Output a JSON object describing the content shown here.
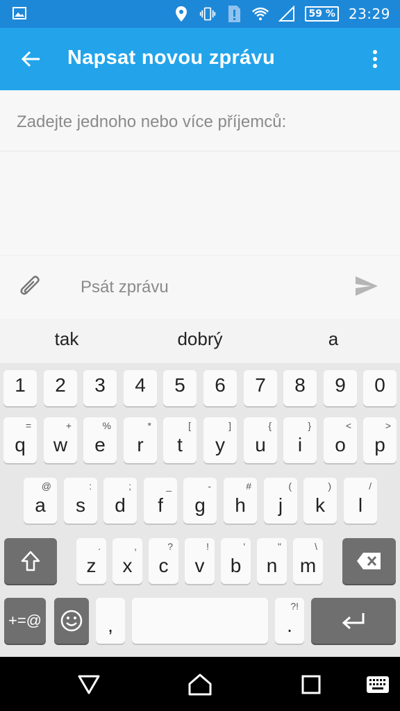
{
  "status_bar": {
    "battery": "59 %",
    "time": "23:29",
    "icons": [
      "image-icon",
      "location-icon",
      "vibrate-icon",
      "alert-icon",
      "wifi-icon",
      "signal-icon",
      "battery-icon"
    ]
  },
  "app_bar": {
    "title": "Napsat novou zprávu"
  },
  "recipients": {
    "placeholder": "Zadejte jednoho nebo více příjemců:"
  },
  "compose": {
    "placeholder": "Psát zprávu"
  },
  "suggestions": [
    "tak",
    "dobrý",
    "a"
  ],
  "keyboard": {
    "row_numbers": [
      "1",
      "2",
      "3",
      "4",
      "5",
      "6",
      "7",
      "8",
      "9",
      "0"
    ],
    "row1": [
      {
        "k": "q",
        "a": "="
      },
      {
        "k": "w",
        "a": "+"
      },
      {
        "k": "e",
        "a": "%"
      },
      {
        "k": "r",
        "a": "*"
      },
      {
        "k": "t",
        "a": "["
      },
      {
        "k": "y",
        "a": "]"
      },
      {
        "k": "u",
        "a": "{"
      },
      {
        "k": "i",
        "a": "}"
      },
      {
        "k": "o",
        "a": "<"
      },
      {
        "k": "p",
        "a": ">"
      }
    ],
    "row2": [
      {
        "k": "a",
        "a": "@"
      },
      {
        "k": "s",
        "a": ":"
      },
      {
        "k": "d",
        "a": ";"
      },
      {
        "k": "f",
        "a": "_"
      },
      {
        "k": "g",
        "a": "-"
      },
      {
        "k": "h",
        "a": "#"
      },
      {
        "k": "j",
        "a": "("
      },
      {
        "k": "k",
        "a": ")"
      },
      {
        "k": "l",
        "a": "/"
      }
    ],
    "row3": [
      {
        "k": "z",
        "a": "."
      },
      {
        "k": "x",
        "a": ","
      },
      {
        "k": "c",
        "a": "?"
      },
      {
        "k": "v",
        "a": "!"
      },
      {
        "k": "b",
        "a": "'"
      },
      {
        "k": "n",
        "a": "\""
      },
      {
        "k": "m",
        "a": "\\"
      }
    ],
    "symbols_label": "+=@",
    "comma": ",",
    "period": ".",
    "period_alt": "?!"
  },
  "colors": {
    "status_bar": "#1e88d8",
    "app_bar": "#23a4ea",
    "keyboard_bg": "#e7e7e7",
    "key": "#fafafa",
    "key_dark": "#6f6f6f"
  }
}
